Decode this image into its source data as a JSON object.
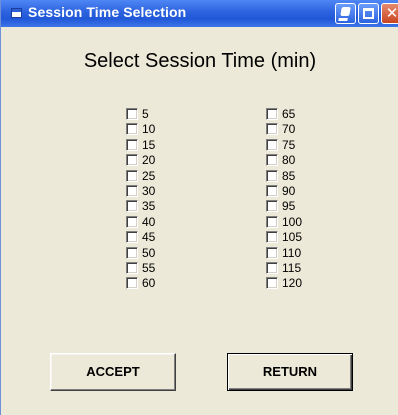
{
  "window": {
    "title": "Session Time Selection"
  },
  "heading": "Select Session Time (min)",
  "options_left": [
    "5",
    "10",
    "15",
    "20",
    "25",
    "30",
    "35",
    "40",
    "45",
    "50",
    "55",
    "60"
  ],
  "options_right": [
    "65",
    "70",
    "75",
    "80",
    "85",
    "90",
    "95",
    "100",
    "105",
    "110",
    "115",
    "120"
  ],
  "buttons": {
    "accept_label": "ACCEPT",
    "return_label": "RETURN"
  },
  "colors": {
    "titlebar": "#2058d8",
    "window_bg": "#ece9d8",
    "close_button": "#c9451f"
  }
}
